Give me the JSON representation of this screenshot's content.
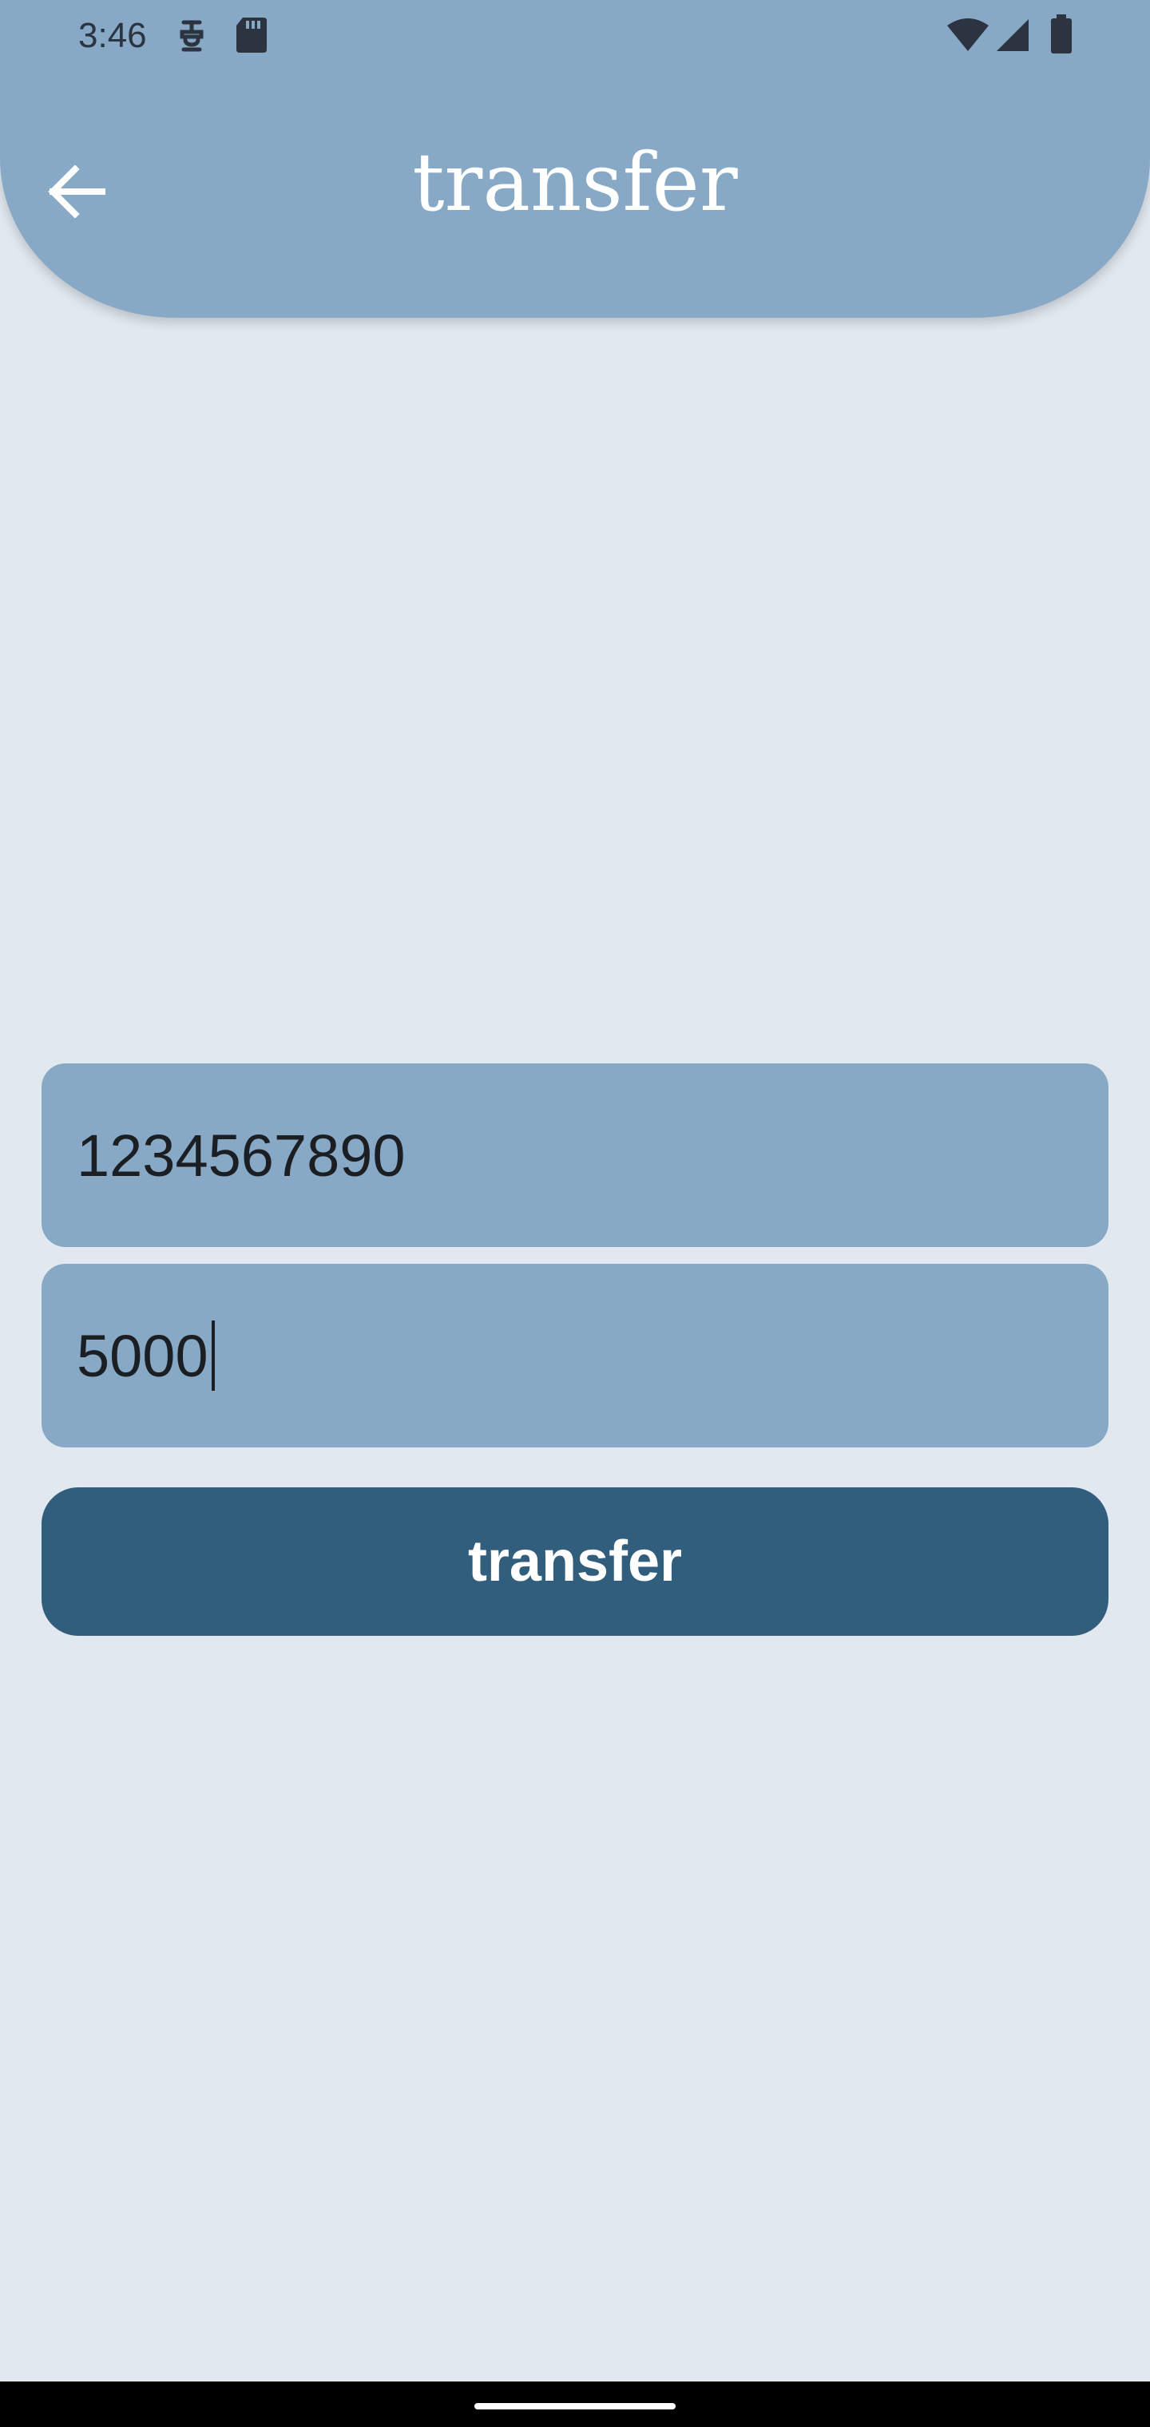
{
  "status_bar": {
    "time": "3:46",
    "icons_left": [
      "vpn-key-icon",
      "sd-card-icon"
    ],
    "icons_right": [
      "wifi-icon",
      "cell-signal-icon",
      "battery-icon"
    ]
  },
  "header": {
    "title": "transfer",
    "back_icon": "arrow-left-icon",
    "background_color": "#87a9c6"
  },
  "form": {
    "account_field": {
      "value": "1234567890"
    },
    "amount_field": {
      "value": "5000",
      "focused": true
    },
    "field_color": "#87a9c6"
  },
  "transfer_button": {
    "label": "transfer",
    "color": "#325e7e"
  },
  "nav_bar": {
    "home_indicator": "home-indicator"
  },
  "colors": {
    "background": "#e1e8f0",
    "text_dark": "#1b1f24",
    "text_light": "#ffffff"
  }
}
